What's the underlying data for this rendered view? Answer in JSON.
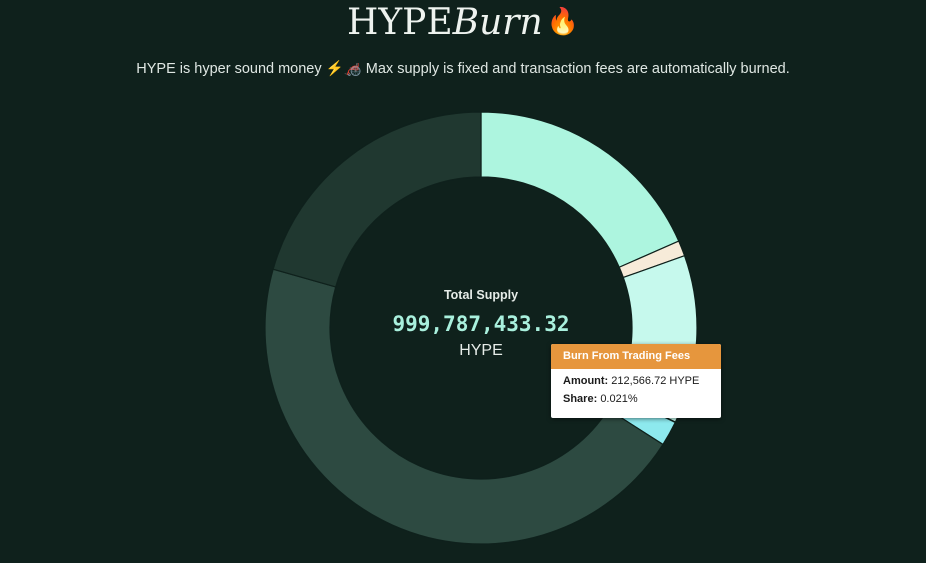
{
  "header": {
    "title_main": "HYPE",
    "title_accent": "Burn",
    "title_emoji": "🔥",
    "subtitle": "HYPE is hyper sound money ⚡🦽 Max supply is fixed and transaction fees are automatically burned."
  },
  "center": {
    "label": "Total Supply",
    "value": "999,787,433.32",
    "unit": "HYPE"
  },
  "tooltip": {
    "title": "Burn From Trading Fees",
    "amount_label": "Amount:",
    "amount_value": "212,566.72 HYPE",
    "share_label": "Share:",
    "share_value": "0.021%"
  },
  "colors": {
    "background": "#0f211c",
    "accent": "#a9f0dd",
    "tooltip_header": "#e6963d"
  },
  "chart_data": {
    "type": "pie",
    "variant": "donut",
    "start_angle_deg": 0,
    "direction": "clockwise",
    "slices": [
      {
        "color": "#adf5df",
        "share": 0.184
      },
      {
        "color": "#f7ebd9",
        "share": 0.0116
      },
      {
        "color": "#c6f9ed",
        "share": 0.126
      },
      {
        "color": "#e6963d",
        "share": 0.00021
      },
      {
        "color": "#8de9ee",
        "share": 0.0186
      },
      {
        "color": "#2d4a41",
        "share": 0.453
      },
      {
        "color": "#203830",
        "share": 0.206
      }
    ]
  }
}
